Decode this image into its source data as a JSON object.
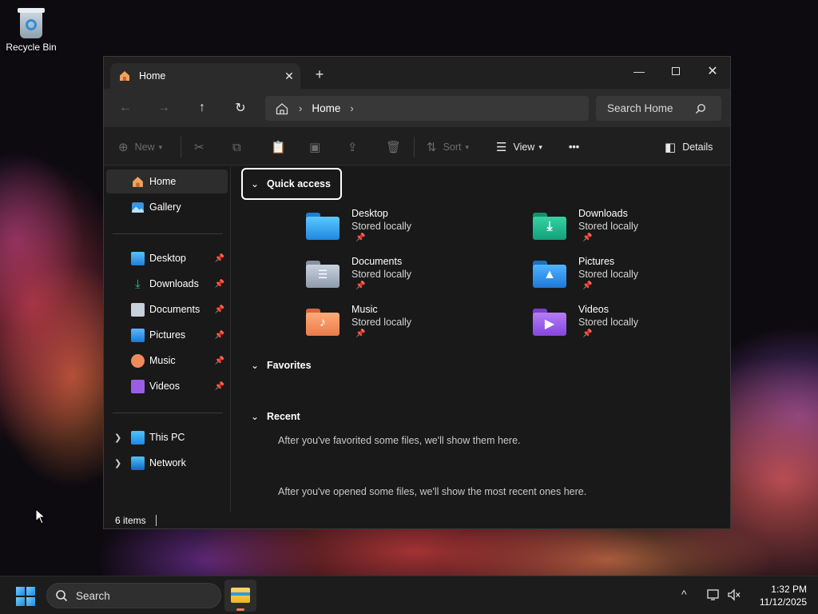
{
  "desktop": {
    "icons": [
      {
        "label": "Recycle Bin",
        "icon": "recycle-bin-icon"
      }
    ]
  },
  "window": {
    "tab": {
      "label": "Home",
      "icon": "home-icon"
    },
    "new_tab_glyph": "+",
    "close_tab_glyph": "✕",
    "controls": {
      "minimize": "—",
      "close": "✕"
    }
  },
  "navigation": {
    "back_glyph": "←",
    "forward_glyph": "→",
    "up_glyph": "↑",
    "refresh_glyph": "↻",
    "breadcrumb": [
      "Home"
    ],
    "chevron": "›",
    "search_placeholder": "Search Home"
  },
  "commandbar": {
    "new_label": "New",
    "sort_label": "Sort",
    "view_label": "View",
    "more_glyph": "•••",
    "details_label": "Details"
  },
  "sidebar": {
    "top": [
      {
        "label": "Home",
        "icon": "home-icon",
        "selected": true
      },
      {
        "label": "Gallery",
        "icon": "gallery-icon"
      }
    ],
    "pinned": [
      {
        "label": "Desktop",
        "icon": "desktop-folder-icon"
      },
      {
        "label": "Downloads",
        "icon": "downloads-icon"
      },
      {
        "label": "Documents",
        "icon": "documents-icon"
      },
      {
        "label": "Pictures",
        "icon": "pictures-icon"
      },
      {
        "label": "Music",
        "icon": "music-icon"
      },
      {
        "label": "Videos",
        "icon": "videos-icon"
      }
    ],
    "pin_glyph": "📌",
    "locations": [
      {
        "label": "This PC",
        "icon": "this-pc-icon"
      },
      {
        "label": "Network",
        "icon": "network-icon"
      }
    ]
  },
  "content": {
    "quick_access": {
      "title": "Quick access",
      "items": [
        {
          "name": "Desktop",
          "sub": "Stored locally",
          "icon": "desktop-folder-icon",
          "color": "#3aa0e8"
        },
        {
          "name": "Downloads",
          "sub": "Stored locally",
          "icon": "downloads-folder-icon",
          "color": "#1fb58f"
        },
        {
          "name": "Documents",
          "sub": "Stored locally",
          "icon": "documents-folder-icon",
          "color": "#9aa7b8"
        },
        {
          "name": "Pictures",
          "sub": "Stored locally",
          "icon": "pictures-folder-icon",
          "color": "#2f8fe0"
        },
        {
          "name": "Music",
          "sub": "Stored locally",
          "icon": "music-folder-icon",
          "color": "#f08a5d"
        },
        {
          "name": "Videos",
          "sub": "Stored locally",
          "icon": "videos-folder-icon",
          "color": "#9b5de5"
        }
      ]
    },
    "favorites": {
      "title": "Favorites",
      "note": "After you've favorited some files, we'll show them here."
    },
    "recent": {
      "title": "Recent",
      "note": "After you've opened some files, we'll show the most recent ones here."
    }
  },
  "status": {
    "items_text": "6 items"
  },
  "taskbar": {
    "search_label": "Search",
    "tray_chevron": "^",
    "time": "1:32 PM",
    "date": "11/12/2025"
  },
  "colors": {
    "window_bg": "#191919",
    "titlebar_bg": "#202020",
    "accent": "#3a96dd"
  }
}
